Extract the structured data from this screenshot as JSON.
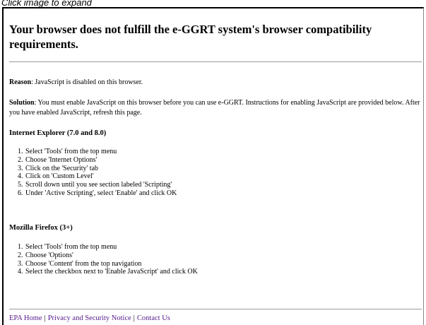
{
  "caption": "Click image to expand",
  "page": {
    "title": "Your browser does not fulfill the e-GGRT system's browser compatibility requirements.",
    "reason_label": "Reason",
    "reason_text": ": JavaScript is disabled on this browser.",
    "solution_label": "Solution",
    "solution_text": ": You must enable JavaScript on this browser before you can use e-GGRT. Instructions for enabling JavaScript are provided below. After you have enabled JavaScript, refresh this page."
  },
  "ie": {
    "heading": "Internet Explorer (7.0 and 8.0)",
    "steps": [
      "Select 'Tools' from the top menu",
      "Choose 'Internet Options'",
      "Click on the 'Security' tab",
      "Click on 'Custom Level'",
      "Scroll down until you see section labeled 'Scripting'",
      "Under 'Active Scripting', select 'Enable' and click OK"
    ]
  },
  "firefox": {
    "heading": "Mozilla Firefox (3+)",
    "steps": [
      "Select 'Tools' from the top menu",
      "Choose 'Options'",
      "Choose 'Content' from the top navigation",
      "Select the checkbox next to 'Enable JavaScript' and click OK"
    ]
  },
  "footer": {
    "links": [
      "EPA Home",
      "Privacy and Security Notice",
      "Contact Us"
    ],
    "separator": "|"
  }
}
